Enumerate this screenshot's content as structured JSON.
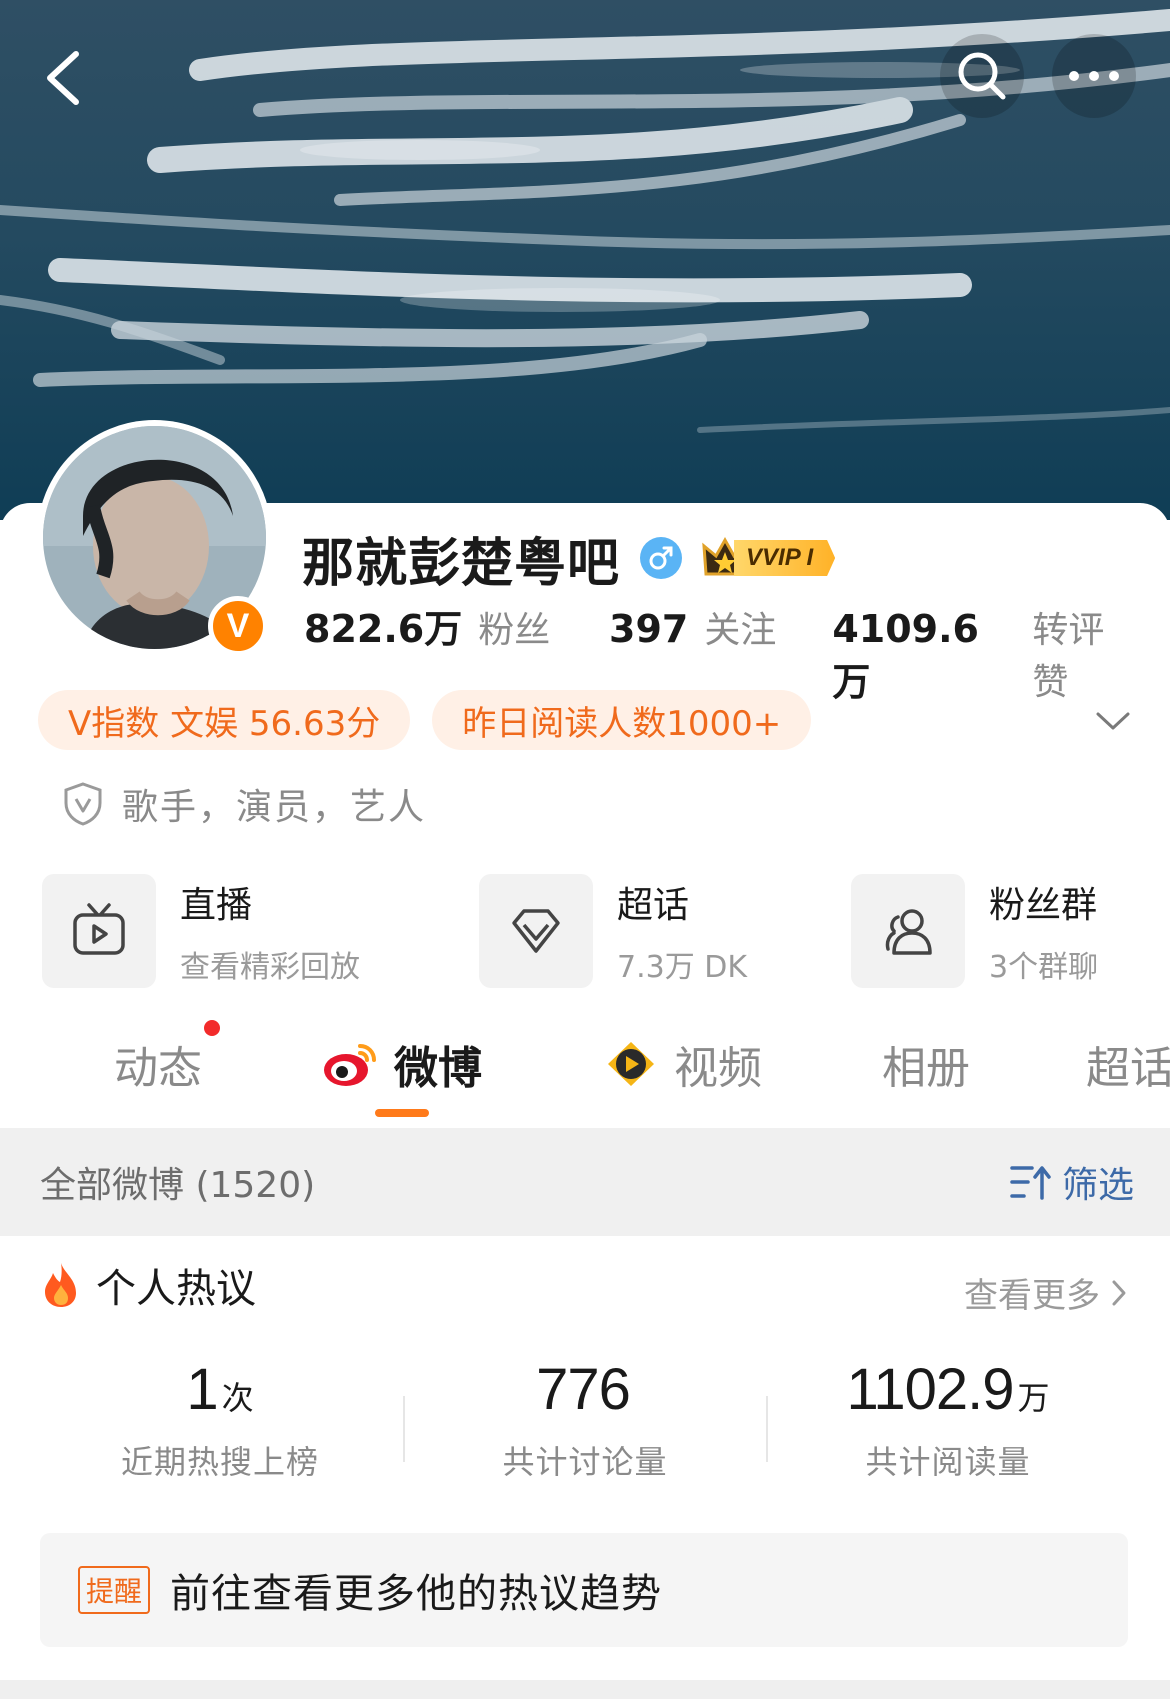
{
  "cover": {
    "icons": [
      "back-icon",
      "search-icon",
      "more-icon"
    ]
  },
  "profile": {
    "name": "那就彭楚粤吧",
    "gender_icon": "male-icon",
    "vip_badge": "VVIP I",
    "verified_badge": "V",
    "stats": [
      {
        "value": "822.6万",
        "label": "粉丝"
      },
      {
        "value": "397",
        "label": "关注"
      },
      {
        "value": "4109.6万",
        "label": "转评赞"
      }
    ],
    "tags": [
      "V指数 文娱 56.63分",
      "昨日阅读人数1000+"
    ],
    "intro": "歌手，演员，艺人"
  },
  "features": [
    {
      "title": "直播",
      "subtitle": "查看精彩回放",
      "icon": "tv-icon"
    },
    {
      "title": "超话",
      "subtitle": "7.3万 DK",
      "icon": "diamond-icon"
    },
    {
      "title": "粉丝群",
      "subtitle": "3个群聊",
      "icon": "group-icon"
    }
  ],
  "tabs": [
    {
      "label": "动态",
      "active": false,
      "has_dot": true
    },
    {
      "label": "微博",
      "active": true,
      "icon": "weibo-icon"
    },
    {
      "label": "视频",
      "active": false,
      "icon": "video-icon"
    },
    {
      "label": "相册",
      "active": false
    },
    {
      "label": "超话",
      "active": false
    }
  ],
  "feed": {
    "title": "全部微博 (1520)",
    "filter_label": "筛选"
  },
  "hot": {
    "title": "个人热议",
    "more_label": "查看更多",
    "metrics": [
      {
        "value": "1",
        "unit": "次",
        "label": "近期热搜上榜"
      },
      {
        "value": "776",
        "unit": "",
        "label": "共计讨论量"
      },
      {
        "value": "1102.9",
        "unit": "万",
        "label": "共计阅读量"
      }
    ],
    "reminder": {
      "tag": "提醒",
      "text": "前往查看更多他的热议趋势"
    }
  },
  "colors": {
    "accent": "#ff8200",
    "tag_bg": "#fff0e6",
    "tag_text": "#f06a1c",
    "link": "#3d6aa8",
    "dot": "#f22b2b"
  }
}
